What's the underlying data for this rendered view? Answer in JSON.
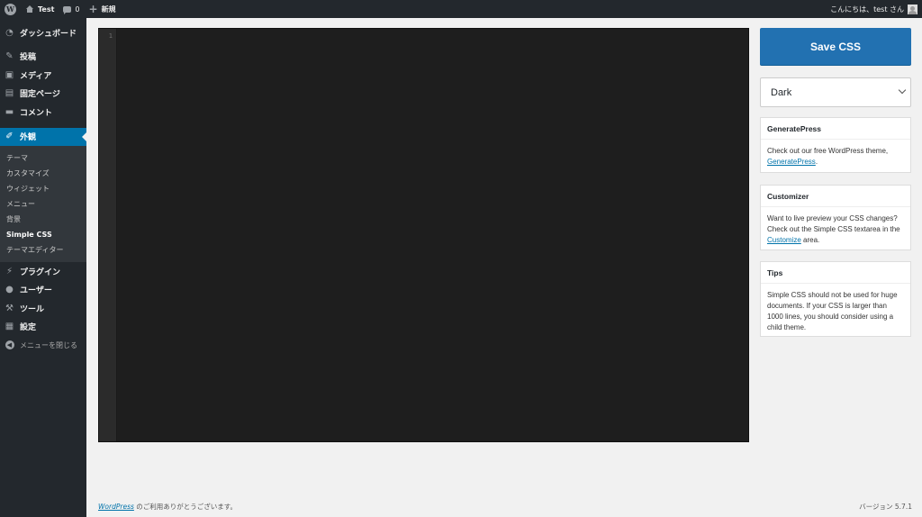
{
  "admin_bar": {
    "site_name": "Test",
    "comments_count": "0",
    "new_label": "新規",
    "greeting": "こんにちは、test さん"
  },
  "sidebar": {
    "items": [
      {
        "label": "ダッシュボード",
        "icon": "dashboard-icon"
      },
      {
        "label": "投稿",
        "icon": "pin-icon"
      },
      {
        "label": "メディア",
        "icon": "media-icon"
      },
      {
        "label": "固定ページ",
        "icon": "page-icon"
      },
      {
        "label": "コメント",
        "icon": "comment-icon"
      },
      {
        "label": "外観",
        "icon": "appearance-icon",
        "current": true
      }
    ],
    "submenu": [
      "テーマ",
      "カスタマイズ",
      "ウィジェット",
      "メニュー",
      "背景",
      "Simple CSS",
      "テーマエディター"
    ],
    "submenu_current": "Simple CSS",
    "items_after": [
      {
        "label": "プラグイン",
        "icon": "plugin-icon"
      },
      {
        "label": "ユーザー",
        "icon": "user-icon"
      },
      {
        "label": "ツール",
        "icon": "wrench-icon"
      },
      {
        "label": "設定",
        "icon": "settings-icon"
      }
    ],
    "collapse_label": "メニューを閉じる"
  },
  "editor": {
    "line_number": "1"
  },
  "actions": {
    "save_label": "Save CSS",
    "theme_selected": "Dark"
  },
  "boxes": {
    "generatepress": {
      "title": "GeneratePress",
      "text_before": "Check out our free WordPress theme, ",
      "link": "GeneratePress",
      "text_after": "."
    },
    "customizer": {
      "title": "Customizer",
      "text_before": "Want to live preview your CSS changes? Check out the Simple CSS textarea in the ",
      "link": "Customize",
      "text_after": " area."
    },
    "tips": {
      "title": "Tips",
      "text": "Simple CSS should not be used for huge documents. If your CSS is larger than 1000 lines, you should consider using a child theme."
    }
  },
  "footer": {
    "link": "WordPress",
    "text": " のご利用ありがとうございます。",
    "version": "バージョン 5.7.1"
  }
}
